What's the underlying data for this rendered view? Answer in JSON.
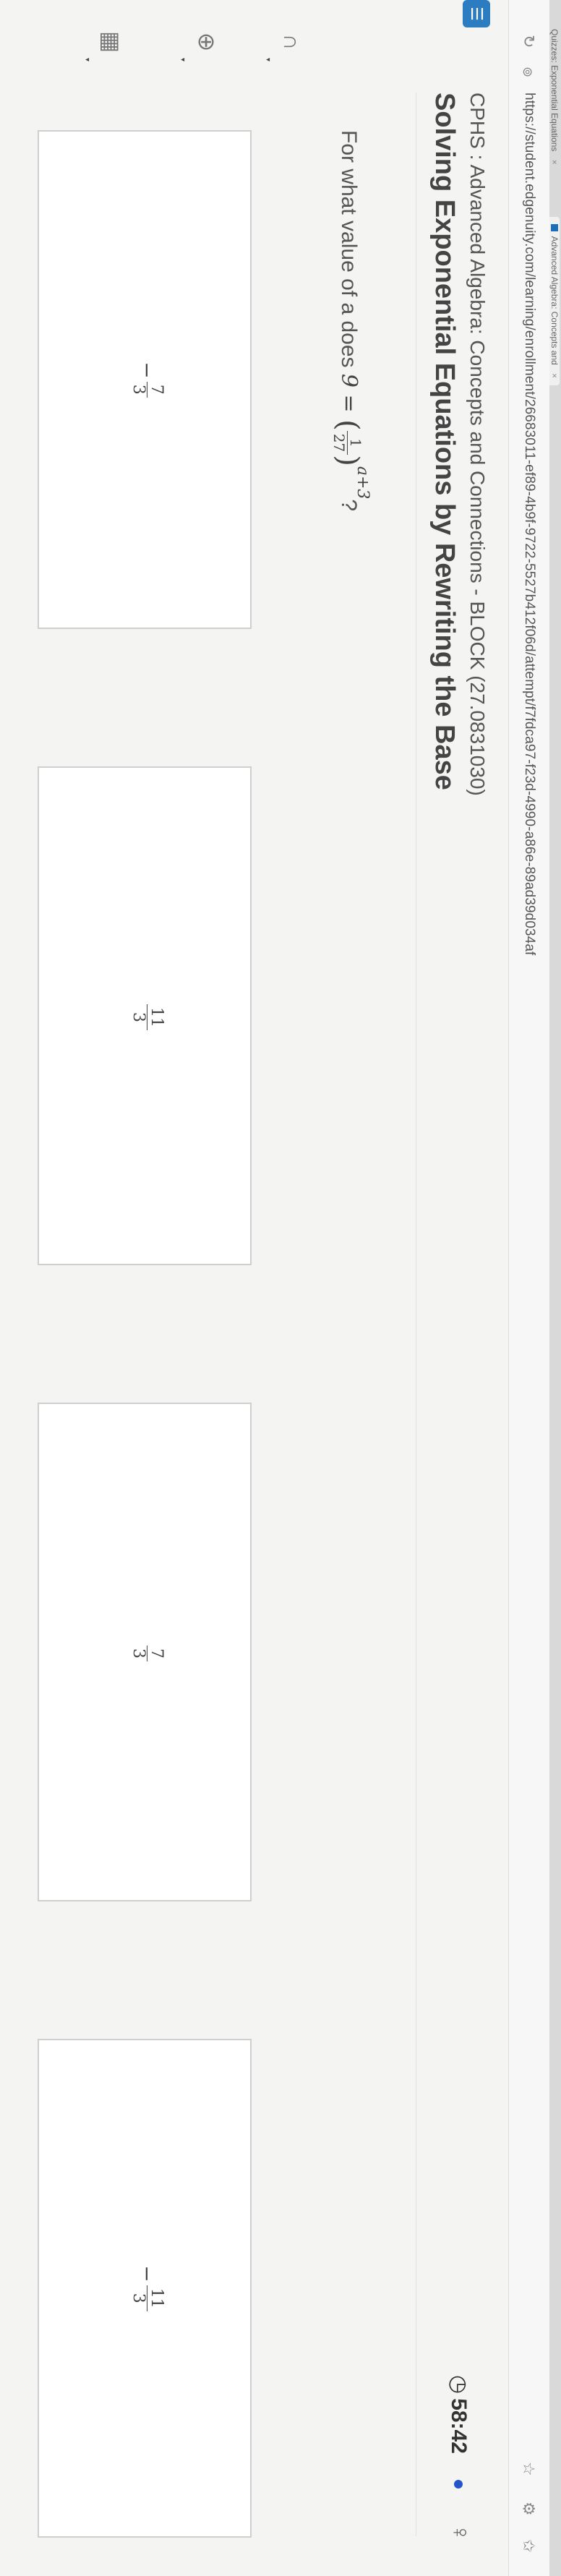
{
  "browser": {
    "tabs": [
      {
        "label": "Quizzes: Exponential Equations"
      },
      {
        "label": "Advanced Algebra: Concepts and"
      }
    ],
    "tab_close": "×",
    "url": "https://student.edgenuity.com/learning/enrollment/26683011-ef89-4b9f-9722-5527b412f06d/attempt/f7fdca97-f23d-4990-a86e-89ad39d034af"
  },
  "icons": {
    "reload": "reload-icon",
    "secure": "lock-icon",
    "star": "star-icon",
    "extension": "puzzle-icon",
    "favorites": "favorites-icon",
    "logo": "menu-icon",
    "headphones": "headphones-icon",
    "translate": "globe-icon",
    "calculator": "calculator-icon",
    "clock": "clock-icon",
    "help": "help-icon"
  },
  "header": {
    "course": "CPHS : Advanced Algebra: Concepts and Connections - BLOCK (27.0831030)",
    "lesson": "Solving Exponential Equations by Rewriting the Base",
    "timer": "58:42"
  },
  "question": {
    "prefix": "For what value of a does ",
    "lhs": "9",
    "equals": " = ",
    "frac_num": "1",
    "frac_den": "27",
    "exponent": "a+3",
    "suffix": "?"
  },
  "choices": [
    {
      "sign": "−",
      "num": "7",
      "den": "3"
    },
    {
      "sign": "",
      "num": "11",
      "den": "3"
    },
    {
      "sign": "",
      "num": "7",
      "den": "3"
    },
    {
      "sign": "−",
      "num": "11",
      "den": "3"
    }
  ],
  "colors": {
    "accent": "#2b7cc1",
    "status_dot": "#2355c9"
  }
}
